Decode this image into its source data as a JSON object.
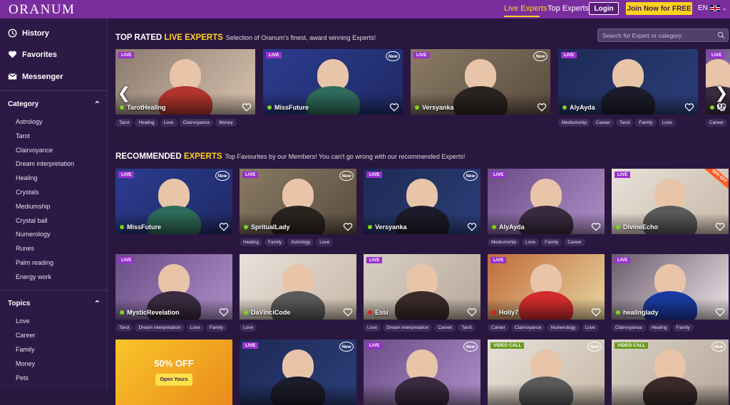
{
  "header": {
    "logo": "ORANUM",
    "nav_live": "Live Experts",
    "nav_top": "Top Experts",
    "login": "Login",
    "join": "Join Now for FREE",
    "lang": "EN"
  },
  "sidebar": {
    "history": "History",
    "favorites": "Favorites",
    "messenger": "Messenger",
    "category_title": "Category",
    "categories": [
      "Astrology",
      "Tarot",
      "Clairvoyance",
      "Dream interpretation",
      "Healing",
      "Crystals",
      "Mediumship",
      "Crystal ball",
      "Numerology",
      "Runes",
      "Palm reading",
      "Energy work"
    ],
    "topics_title": "Topics",
    "topics": [
      "Love",
      "Career",
      "Family",
      "Money",
      "Pets"
    ]
  },
  "search": {
    "placeholder": "Search for Expert or category"
  },
  "top_rated": {
    "title_a": "TOP RATED ",
    "title_b": "LIVE EXPERTS",
    "subtitle": "Selection of Oranum's finest, award winning Experts!",
    "cards": [
      {
        "name": "TarotHealing",
        "live": "LIVE",
        "tags": [
          "Tarot",
          "Healing",
          "Love",
          "Clairvoyance",
          "Money"
        ]
      },
      {
        "name": "MissFuture",
        "live": "LIVE",
        "new": "New",
        "tags": []
      },
      {
        "name": "Versyanka",
        "live": "LIVE",
        "new": "New",
        "tags": []
      },
      {
        "name": "AlyAyda",
        "live": "LIVE",
        "tags": [
          "Mediumship",
          "Career",
          "Tarot",
          "Family",
          "Love"
        ]
      },
      {
        "name": "My",
        "live": "LIVE",
        "tags": [
          "Career"
        ]
      }
    ]
  },
  "recommended": {
    "title_a": "RECOMMENDED ",
    "title_b": "EXPERTS",
    "subtitle": "Top Favourites by our Members! You can't go wrong with our recommended Experts!",
    "row1": [
      {
        "name": "MissFuture",
        "live": "LIVE",
        "new": "New",
        "tags": []
      },
      {
        "name": "SpritualLady",
        "live": "LIVE",
        "new": "New",
        "tags": [
          "Healing",
          "Family",
          "Astrology",
          "Love"
        ]
      },
      {
        "name": "Versyanka",
        "live": "LIVE",
        "new": "New",
        "tags": []
      },
      {
        "name": "AlyAyda",
        "live": "LIVE",
        "tags": [
          "Mediumship",
          "Love",
          "Family",
          "Career"
        ]
      },
      {
        "name": "DivineEcho",
        "live": "LIVE",
        "badge": "50% OFF",
        "tags": []
      }
    ],
    "row2": [
      {
        "name": "MysticRevelation",
        "live": "LIVE",
        "tags": [
          "Tarot",
          "Dream interpretation",
          "Love",
          "Family"
        ]
      },
      {
        "name": "DaVinciCode",
        "live": "",
        "tags": [
          "Love"
        ]
      },
      {
        "name": "Essi",
        "live": "LIVE",
        "tags": [
          "Love",
          "Dream interpretation",
          "Career",
          "Tarot"
        ]
      },
      {
        "name": "Holly7",
        "live": "LIVE",
        "tags": [
          "Career",
          "Clairvoyance",
          "Numerology",
          "Love"
        ]
      },
      {
        "name": "healinglady",
        "live": "LIVE",
        "tags": [
          "Clairvoyance",
          "Healing",
          "Family"
        ]
      }
    ],
    "row3": [
      {
        "promo_title": "50% OFF",
        "promo_button": "Open Yours"
      },
      {
        "live": "LIVE",
        "new": "New"
      },
      {
        "live": "LIVE",
        "new": "New"
      },
      {
        "live": "VIDEO CALL",
        "new": "New"
      },
      {
        "live": "VIDEO CALL",
        "new": "New"
      }
    ]
  },
  "colors": {
    "bg": "#2a1740",
    "header": "#7a2e9e",
    "accent": "#ffd21f",
    "live": "#9a2fd0",
    "online": "#7ed321"
  }
}
